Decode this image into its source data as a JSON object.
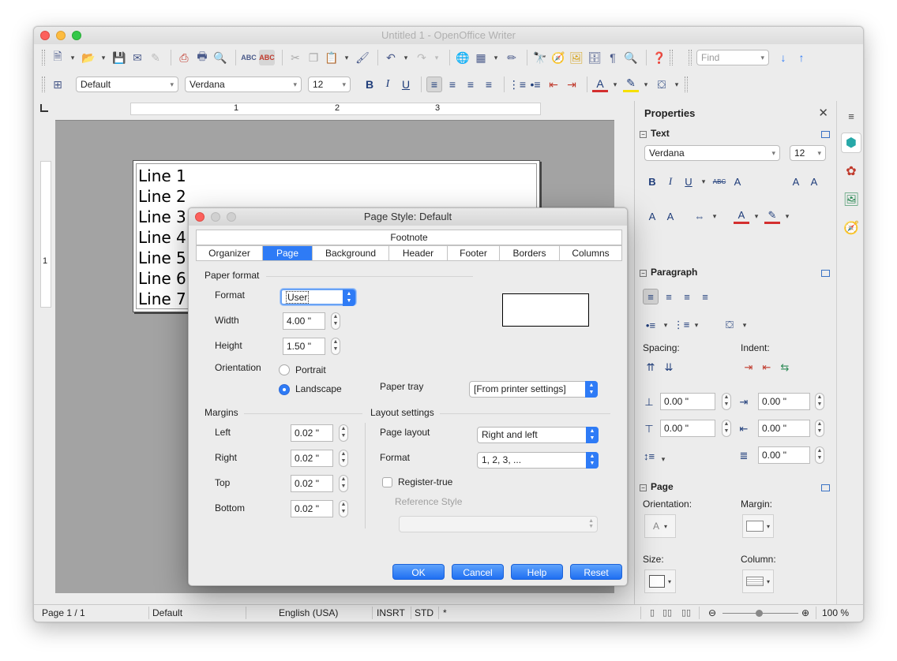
{
  "window": {
    "title": "Untitled 1 - OpenOffice Writer"
  },
  "toolbar": {
    "find_placeholder": "Find",
    "style": "Default",
    "font": "Verdana",
    "size": "12"
  },
  "ruler": {
    "marks": [
      "1",
      "2",
      "3"
    ],
    "vmark": "1"
  },
  "document": {
    "lines": [
      "Line 1",
      "Line 2",
      "Line 3",
      "Line 4",
      "Line 5",
      "Line 6",
      "Line 7"
    ]
  },
  "status": {
    "page": "Page 1 / 1",
    "style": "Default",
    "language": "English (USA)",
    "insert": "INSRT",
    "selection": "STD",
    "modified": "*",
    "zoom": "100 %"
  },
  "sidebar": {
    "title": "Properties",
    "text_section": "Text",
    "font": "Verdana",
    "size": "12",
    "paragraph_section": "Paragraph",
    "spacing_label": "Spacing:",
    "indent_label": "Indent:",
    "spacing_above": "0.00 \"",
    "spacing_below": "0.00 \"",
    "indent_before": "0.00 \"",
    "indent_after": "0.00 \"",
    "indent_first": "0.00 \"",
    "page_section": "Page",
    "orientation_label": "Orientation:",
    "margin_label": "Margin:",
    "size_label": "Size:",
    "column_label": "Column:"
  },
  "dialog": {
    "title": "Page Style: Default",
    "tabs_top": [
      "Footnote"
    ],
    "tabs": [
      "Organizer",
      "Page",
      "Background",
      "Header",
      "Footer",
      "Borders",
      "Columns"
    ],
    "selected_tab": "Page",
    "paper_format_heading": "Paper format",
    "format_label": "Format",
    "format_value": "User",
    "width_label": "Width",
    "width_value": "4.00 \"",
    "height_label": "Height",
    "height_value": "1.50 \"",
    "orientation_label": "Orientation",
    "portrait_label": "Portrait",
    "landscape_label": "Landscape",
    "paper_tray_label": "Paper tray",
    "paper_tray_value": "[From printer settings]",
    "margins_heading": "Margins",
    "left_label": "Left",
    "left_value": "0.02 \"",
    "right_label": "Right",
    "right_value": "0.02 \"",
    "top_label": "Top",
    "top_value": "0.02 \"",
    "bottom_label": "Bottom",
    "bottom_value": "0.02 \"",
    "layout_heading": "Layout settings",
    "page_layout_label": "Page layout",
    "page_layout_value": "Right and left",
    "layout_format_label": "Format",
    "layout_format_value": "1, 2, 3, ...",
    "register_true_label": "Register-true",
    "reference_style_label": "Reference Style",
    "buttons": {
      "ok": "OK",
      "cancel": "Cancel",
      "help": "Help",
      "reset": "Reset"
    }
  },
  "colors": {
    "accent": "#2e7bf6",
    "doc_background": "#a3a3a3"
  }
}
